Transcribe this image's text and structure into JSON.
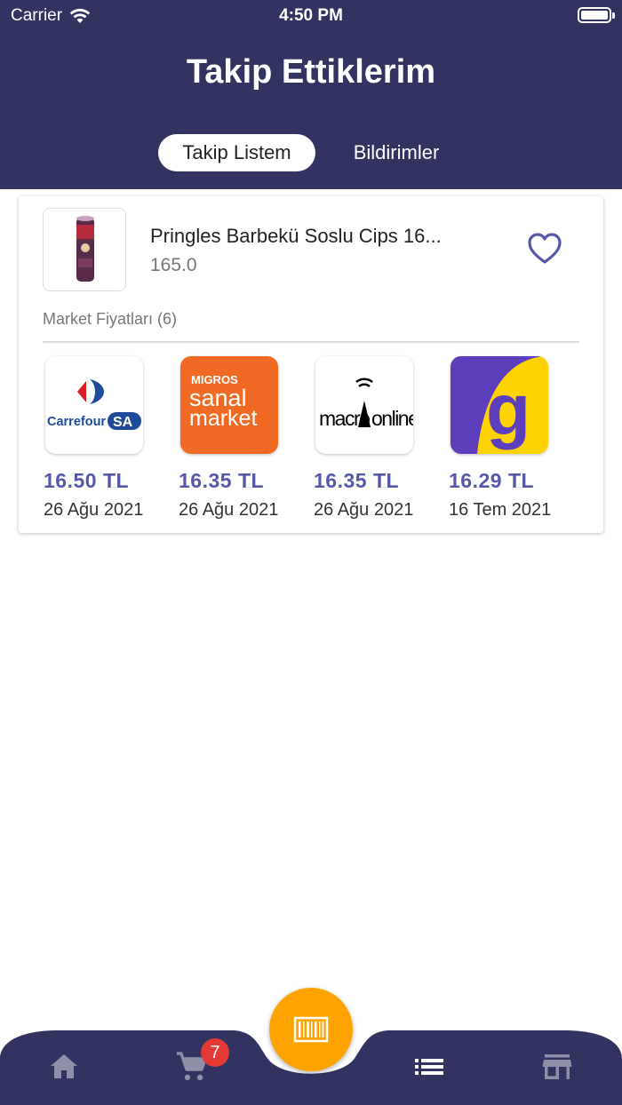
{
  "status_bar": {
    "carrier": "Carrier",
    "time": "4:50 PM"
  },
  "header": {
    "title": "Takip Ettiklerim"
  },
  "tabs": [
    {
      "label": "Takip Listem",
      "active": true
    },
    {
      "label": "Bildirimler",
      "active": false
    }
  ],
  "product": {
    "name": "Pringles Barbekü Soslu Cips 16...",
    "quantity": "165.0",
    "favorite": true,
    "image_icon": "pringles-can-icon"
  },
  "market_prices": {
    "label": "Market Fiyatları (6)",
    "items": [
      {
        "logo": "carrefoursa-logo",
        "logo_text_1": "Carrefour",
        "logo_text_2": "SA",
        "price": "16.50 TL",
        "date": "26 Ağu 2021"
      },
      {
        "logo": "migros-sanal-market-logo",
        "logo_text_1": "MIGROS",
        "logo_text_2": "sanal",
        "logo_text_3": "market",
        "price": "16.35 TL",
        "date": "26 Ağu 2021"
      },
      {
        "logo": "macroonline-logo",
        "logo_text_1": "macro",
        "logo_text_2": "online",
        "price": "16.35 TL",
        "date": "26 Ağu 2021"
      },
      {
        "logo": "getir-logo",
        "logo_text_1": "g",
        "price": "16.29 TL",
        "date": "16 Tem 2021"
      }
    ]
  },
  "bottom_nav": {
    "cart_badge": "7",
    "items": [
      "home-icon",
      "cart-icon",
      "barcode-icon",
      "list-icon",
      "store-icon"
    ]
  },
  "colors": {
    "header_bg": "#323361",
    "accent_price": "#5558a8",
    "fab": "#ffa300",
    "badge": "#e53935",
    "nav_bg": "#323361"
  }
}
